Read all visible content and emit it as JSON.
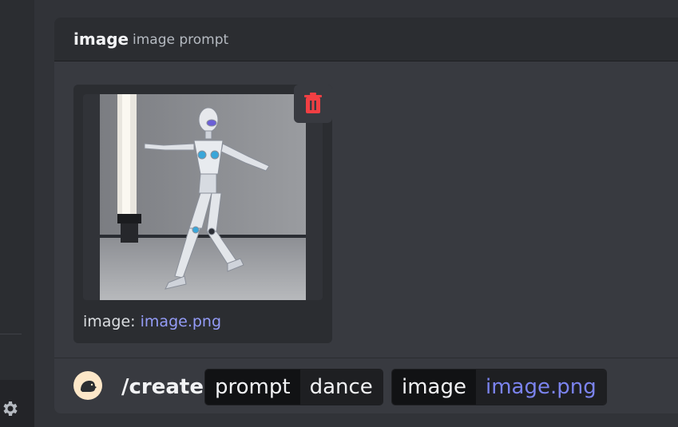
{
  "option_header": {
    "name": "image",
    "description": "image prompt"
  },
  "attachment": {
    "caption_label": "image:",
    "filename": "image.png",
    "delete_icon": "trash-icon",
    "thumbnail_subject": "robot-dancer-image"
  },
  "command_bar": {
    "avatar_icon": "bot-avatar",
    "command": "/create",
    "options": [
      {
        "key": "prompt",
        "value": "dance"
      },
      {
        "key": "image",
        "value": "image.png"
      }
    ]
  },
  "sidebar": {
    "settings_icon": "gear-icon"
  },
  "colors": {
    "background": "#313338",
    "panel": "#383a40",
    "header": "#2b2d31",
    "link": "#949cf7",
    "danger": "#f23f43",
    "avatar_bg": "#fde7c8"
  }
}
